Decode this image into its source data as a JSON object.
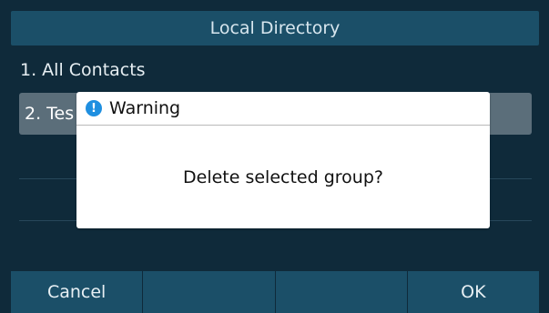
{
  "screen": {
    "title": "Local Directory"
  },
  "list": {
    "items": [
      {
        "label": "1. All Contacts"
      },
      {
        "label": "2. Tes"
      }
    ]
  },
  "dialog": {
    "title": "Warning",
    "icon": "info-icon",
    "message": "Delete selected group?"
  },
  "softkeys": [
    {
      "label": "Cancel"
    },
    {
      "label": ""
    },
    {
      "label": ""
    },
    {
      "label": "OK"
    }
  ],
  "colors": {
    "background": "#0f2a3a",
    "bar": "#1b4f68",
    "selected_row": "#5b6e7a",
    "dialog": "#ffffff",
    "warning_icon": "#1f8fe0"
  }
}
